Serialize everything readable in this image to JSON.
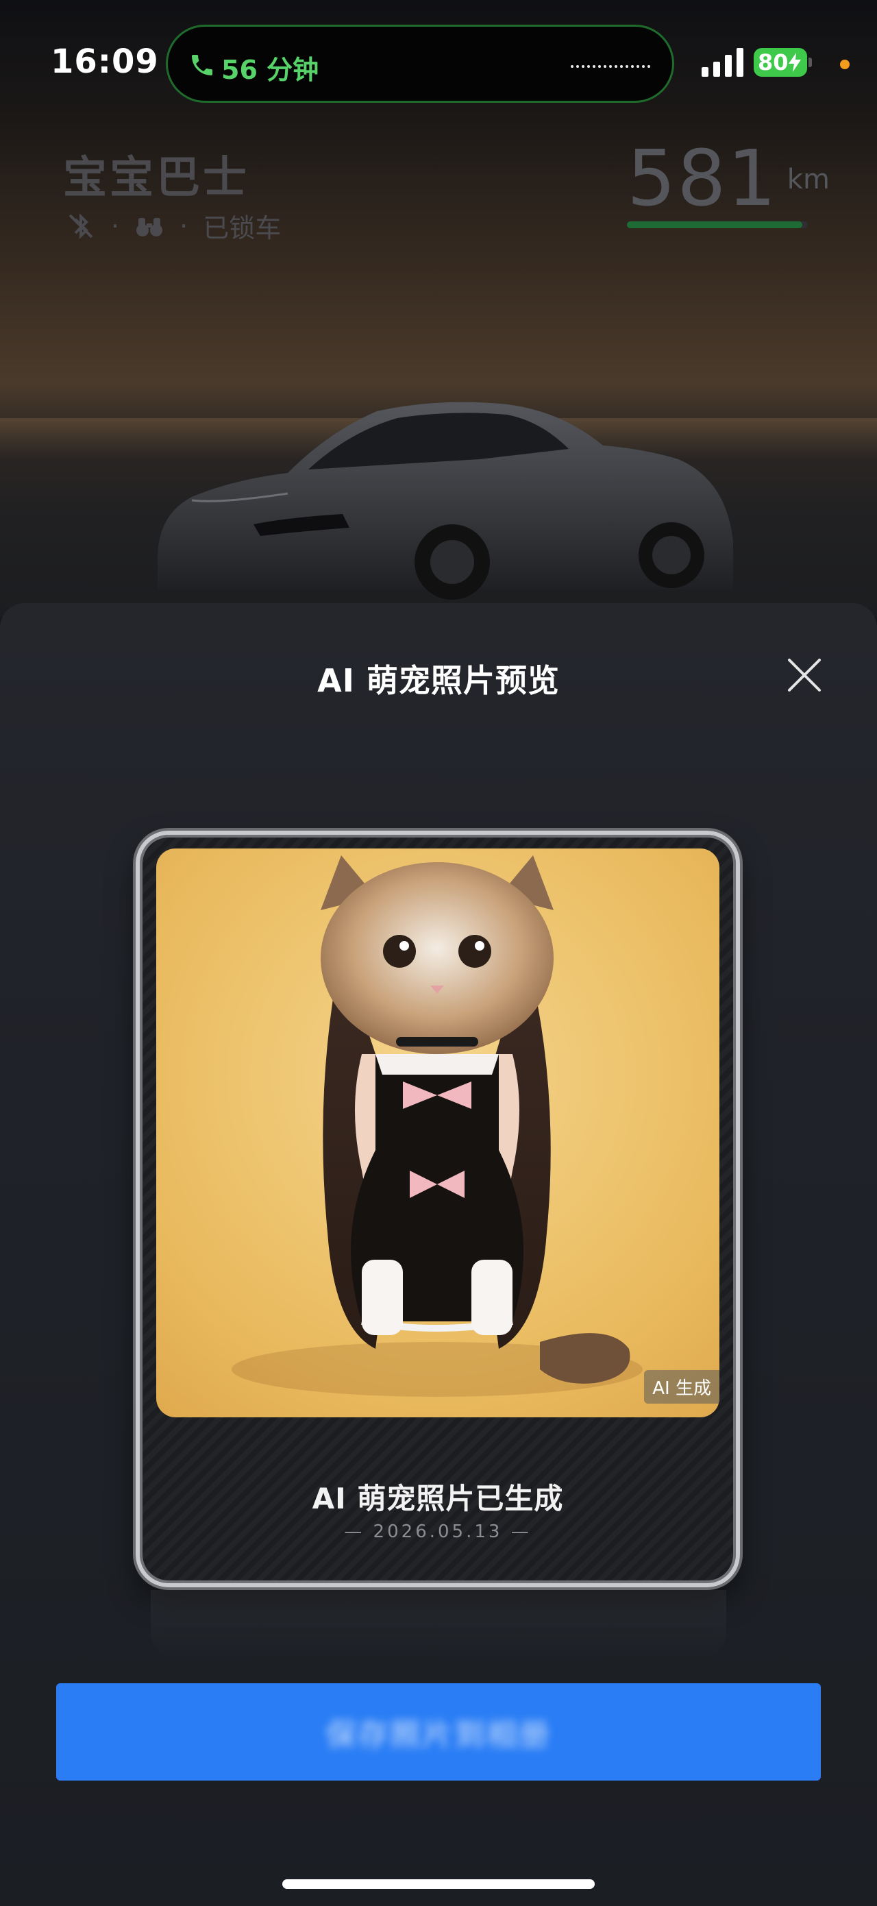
{
  "status_bar": {
    "time": "16:09",
    "call_duration": "56 分钟",
    "battery_level": "80",
    "battery_charging": true,
    "colors": {
      "call_green": "#57d36a",
      "battery_green": "#3ec94b",
      "privacy_dot": "#f29b1e"
    }
  },
  "vehicle": {
    "name": "宝宝巴士",
    "status": "已锁车",
    "icons": [
      "bluetooth-off-icon",
      "binoculars-icon"
    ],
    "range_value": "581",
    "range_unit": "km",
    "range_fraction": 0.97
  },
  "sheet": {
    "title": "AI 萌宠照片预览",
    "photo_badge": "AI 生成",
    "caption": "AI 萌宠照片已生成",
    "date": "—  2026.05.13  —",
    "primary_button_label": "保存照片到相册",
    "colors": {
      "primary": "#2a7df5"
    }
  }
}
